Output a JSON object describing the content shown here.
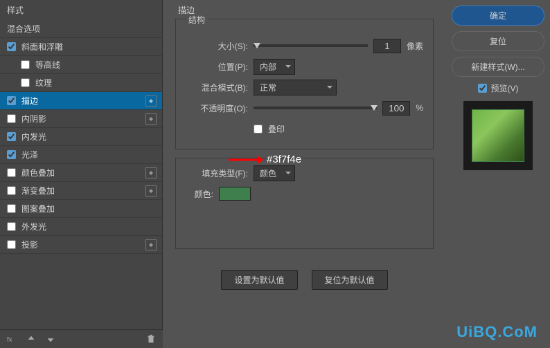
{
  "sidebar": {
    "header": "样式",
    "items": [
      {
        "label": "混合选项",
        "checked": null,
        "plus": false
      },
      {
        "label": "斜面和浮雕",
        "checked": true,
        "plus": false
      },
      {
        "label": "等高线",
        "checked": false,
        "plus": false,
        "indent": true
      },
      {
        "label": "纹理",
        "checked": false,
        "plus": false,
        "indent": true
      },
      {
        "label": "描边",
        "checked": true,
        "plus": true,
        "selected": true
      },
      {
        "label": "内阴影",
        "checked": false,
        "plus": true
      },
      {
        "label": "内发光",
        "checked": true,
        "plus": false
      },
      {
        "label": "光泽",
        "checked": true,
        "plus": false
      },
      {
        "label": "颜色叠加",
        "checked": false,
        "plus": true
      },
      {
        "label": "渐变叠加",
        "checked": false,
        "plus": true
      },
      {
        "label": "图案叠加",
        "checked": false,
        "plus": false
      },
      {
        "label": "外发光",
        "checked": false,
        "plus": false
      },
      {
        "label": "投影",
        "checked": false,
        "plus": true
      }
    ]
  },
  "panel": {
    "title": "描边",
    "struct_title": "结构",
    "size_label": "大小(S):",
    "size_value": "1",
    "size_unit": "像素",
    "pos_label": "位置(P):",
    "pos_value": "内部",
    "blend_label": "混合模式(B):",
    "blend_value": "正常",
    "opacity_label": "不透明度(O):",
    "opacity_value": "100",
    "opacity_unit": "%",
    "overprint_label": "叠印",
    "fill_type_label": "填充类型(F):",
    "fill_type_value": "颜色",
    "color_label": "颜色:",
    "color_hex": "#3f7f4e",
    "default_btn": "设置为默认值",
    "reset_btn": "复位为默认值"
  },
  "right": {
    "ok": "确定",
    "cancel": "复位",
    "new_style": "新建样式(W)...",
    "preview": "预览(V)"
  },
  "watermark": "UiBQ.CoM"
}
